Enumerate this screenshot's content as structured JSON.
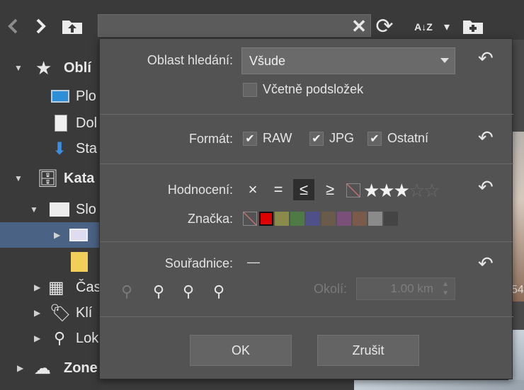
{
  "toolbar": {
    "back_icon": "chevron-left-icon",
    "forward_icon": "chevron-right-icon",
    "up_icon": "folder-up-icon",
    "clear_glyph": "✕",
    "refresh_glyph": "⟳",
    "sort_glyph": "A↓Z",
    "sort_dropdown_glyph": "▾",
    "new_folder_glyph": "+"
  },
  "sidebar": {
    "favorites_label": "Oblí",
    "items": [
      {
        "label": "Plo"
      },
      {
        "label": "Dol"
      },
      {
        "label": "Sta"
      }
    ],
    "catalog_label": "Kata",
    "folders_label": "Slo",
    "calendar_label": "Čas",
    "keywords_label": "Klí",
    "locations_label": "Lok",
    "zoner_label": "Zone"
  },
  "filter": {
    "search_area_label": "Oblast hledání:",
    "search_area_value": "Všude",
    "include_subfolders_label": "Včetně podsložek",
    "include_subfolders_checked": false,
    "format_label": "Formát:",
    "formats": [
      {
        "label": "RAW",
        "checked": true
      },
      {
        "label": "JPG",
        "checked": true
      },
      {
        "label": "Ostatní",
        "checked": true
      }
    ],
    "rating_label": "Hodnocení:",
    "rating_ops": [
      "×",
      "=",
      "≤",
      "≥"
    ],
    "rating_selected_op": "≤",
    "rating_value": 3,
    "rating_max": 5,
    "tag_label": "Značka:",
    "tag_colors": [
      "#e00000",
      "#8a8a4a",
      "#4e7a44",
      "#4f4f8a",
      "#6a5a4a",
      "#7a4f7a",
      "#7a5a48",
      "#8a8a8a",
      "#444444"
    ],
    "coordinates_label": "Souřadnice:",
    "coordinates_value": "—",
    "radius_label": "Okolí:",
    "radius_value": "1.00 km",
    "ok_label": "OK",
    "cancel_label": "Zrušit"
  },
  "photo": {
    "partial_caption": "54"
  }
}
